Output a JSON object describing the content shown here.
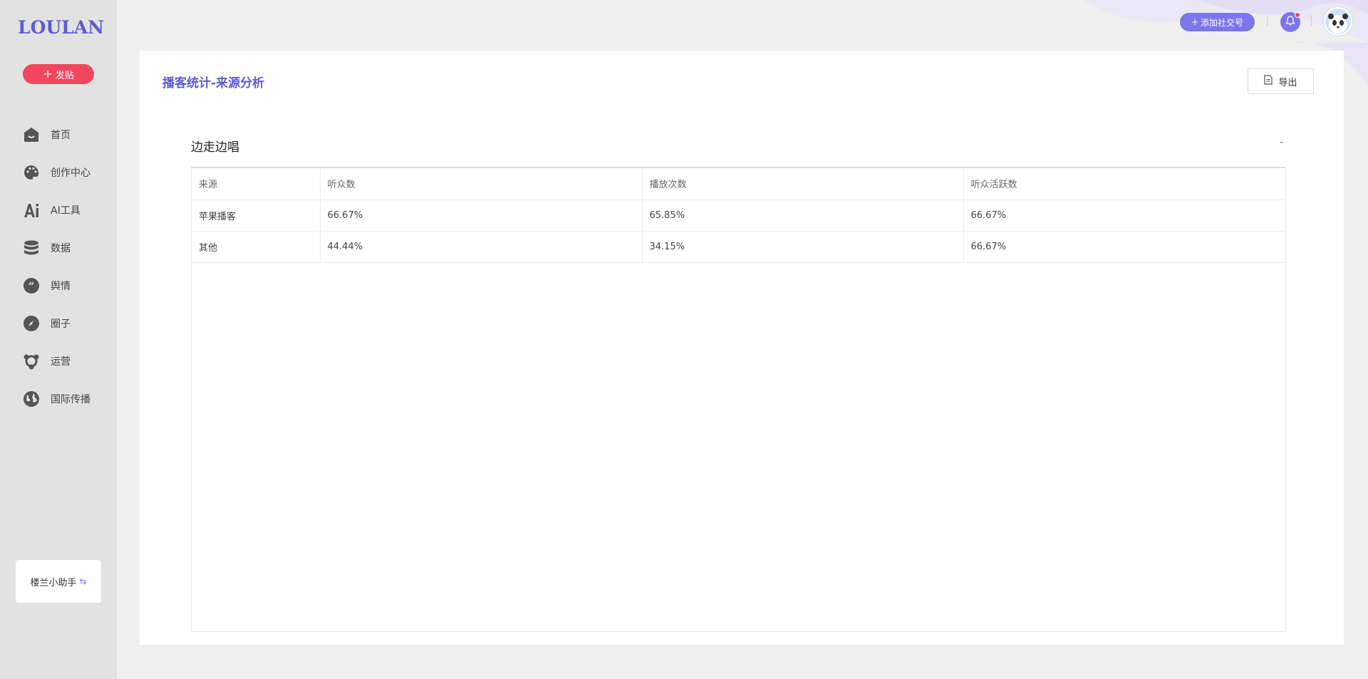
{
  "brand": {
    "logo": "LOULAN"
  },
  "sidebar": {
    "post_button": "发贴",
    "items": [
      {
        "label": "首页",
        "icon": "home-icon"
      },
      {
        "label": "创作中心",
        "icon": "palette-icon"
      },
      {
        "label": "AI工具",
        "icon": "ai-icon"
      },
      {
        "label": "数据",
        "icon": "database-icon"
      },
      {
        "label": "舆情",
        "icon": "quote-icon"
      },
      {
        "label": "圈子",
        "icon": "compass-icon"
      },
      {
        "label": "运营",
        "icon": "network-icon"
      },
      {
        "label": "国际传播",
        "icon": "globe-icon"
      }
    ],
    "helper": {
      "label": "楼兰小助手",
      "icon": "swap-icon"
    }
  },
  "header": {
    "add_social": "添加社交号"
  },
  "main": {
    "title": "播客统计-来源分析",
    "export_label": "导出",
    "section_title": "边走边唱",
    "collapse_symbol": "-",
    "table": {
      "columns": [
        "来源",
        "听众数",
        "播放次数",
        "听众活跃数"
      ],
      "rows": [
        [
          "苹果播客",
          "66.67%",
          "65.85%",
          "66.67%"
        ],
        [
          "其他",
          "44.44%",
          "34.15%",
          "66.67%"
        ]
      ]
    }
  },
  "colors": {
    "accent": "#5d5bd4",
    "button_purple": "#7b76ea",
    "post_red": "#f0465e",
    "sidebar_bg": "#e2e2e2"
  }
}
